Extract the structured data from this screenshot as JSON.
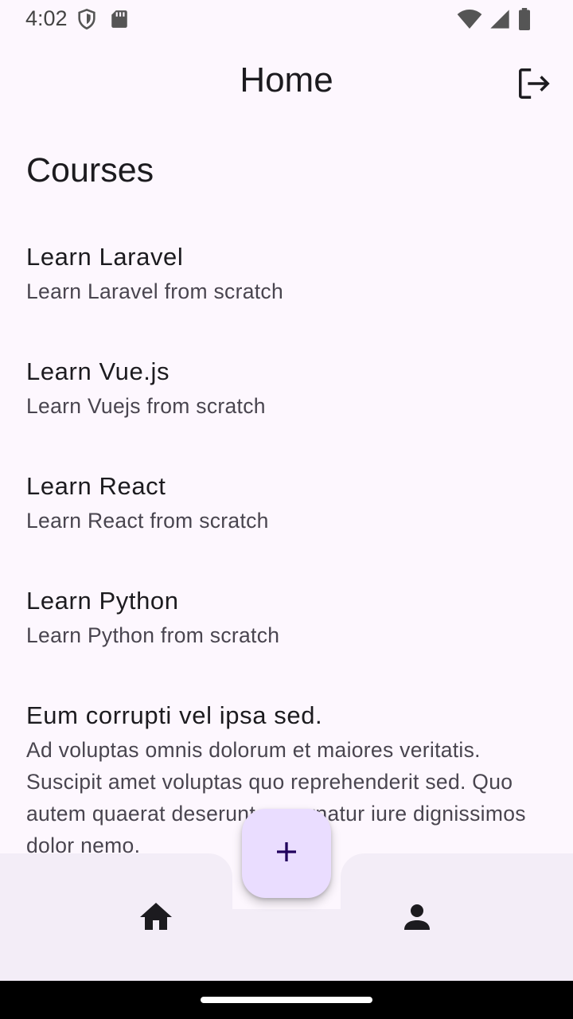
{
  "status_bar": {
    "time": "4:02",
    "left_icons": [
      "shield-icon",
      "sd-card-icon"
    ],
    "right_icons": [
      "wifi-icon",
      "signal-icon",
      "battery-icon"
    ]
  },
  "appbar": {
    "title": "Home",
    "action_icon": "logout-icon"
  },
  "section": {
    "title": "Courses"
  },
  "courses": [
    {
      "title": "Learn Laravel",
      "description": "Learn Laravel from scratch"
    },
    {
      "title": "Learn Vue.js",
      "description": "Learn Vuejs from scratch"
    },
    {
      "title": "Learn React",
      "description": "Learn React from scratch"
    },
    {
      "title": "Learn Python",
      "description": "Learn Python from scratch"
    },
    {
      "title": "Eum corrupti vel ipsa sed.",
      "description": "Ad voluptas omnis dolorum et maiores veritatis. Suscipit amet voluptas quo reprehenderit sed. Quo autem quaerat deserunt aspernatur iure dignissimos dolor nemo."
    }
  ],
  "bottom_nav": {
    "items": [
      {
        "icon": "home-icon"
      },
      {
        "icon": "person-icon"
      }
    ],
    "fab_icon": "plus-icon"
  },
  "colors": {
    "background": "#fdf7fe",
    "bottom_bar": "#f3edf7",
    "fab": "#eaddff",
    "fab_icon": "#21005d"
  }
}
